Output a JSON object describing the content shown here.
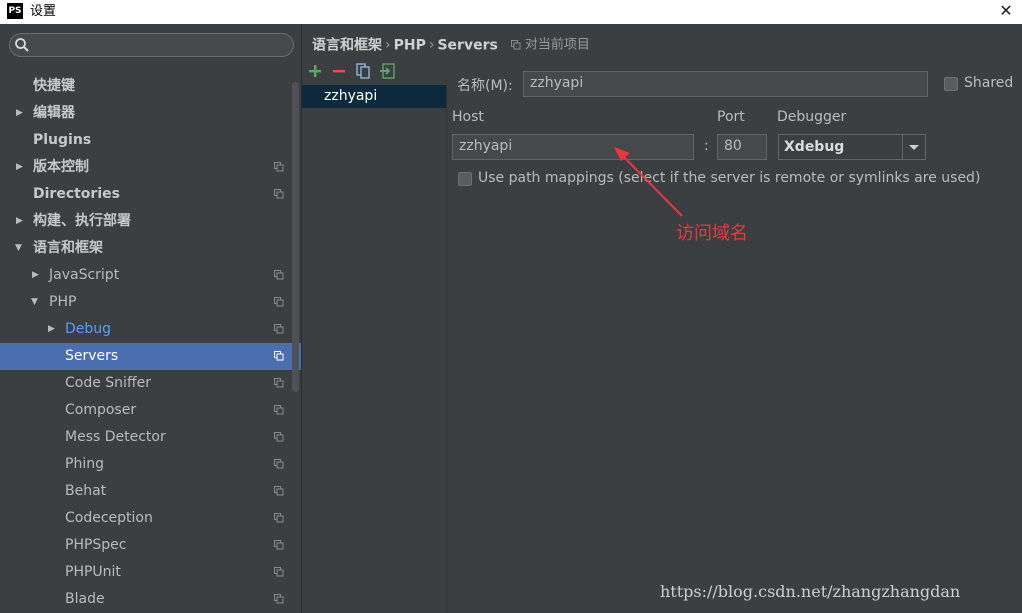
{
  "window": {
    "app_icon_text": "PS",
    "title": "设置",
    "close_glyph": "✕"
  },
  "search": {
    "placeholder": ""
  },
  "tree": {
    "items": [
      {
        "label": "快捷键"
      },
      {
        "label": "编辑器"
      },
      {
        "label": "Plugins"
      },
      {
        "label": "版本控制"
      },
      {
        "label": "Directories"
      },
      {
        "label": "构建、执行部署"
      },
      {
        "label": "语言和框架"
      },
      {
        "label": "JavaScript"
      },
      {
        "label": "PHP"
      },
      {
        "label": "Debug"
      },
      {
        "label": "Servers"
      },
      {
        "label": "Code Sniffer"
      },
      {
        "label": "Composer"
      },
      {
        "label": "Mess Detector"
      },
      {
        "label": "Phing"
      },
      {
        "label": "Behat"
      },
      {
        "label": "Codeception"
      },
      {
        "label": "PHPSpec"
      },
      {
        "label": "PHPUnit"
      },
      {
        "label": "Blade"
      }
    ]
  },
  "breadcrumb": {
    "part1": "语言和框架",
    "sep1": "›",
    "part2": "PHP",
    "sep2": "›",
    "part3": "Servers",
    "scope": "对当前项目"
  },
  "servers": {
    "list": [
      "zzhyapi"
    ]
  },
  "form": {
    "name_label": "名称(M):",
    "name_value": "zzhyapi",
    "shared_label": "Shared",
    "host_label": "Host",
    "host_value": "zzhyapi",
    "colon": ":",
    "port_label": "Port",
    "port_value": "80",
    "debugger_label": "Debugger",
    "debugger_value": "Xdebug",
    "path_mappings_label": "Use path mappings (select if the server is remote or symlinks are used)"
  },
  "annotation": {
    "text": "访问域名",
    "color": "#e8383d"
  },
  "watermark": "https://blog.csdn.net/zhangzhangdan",
  "colors": {
    "selection": "#4b6eaf",
    "background": "#3c3f41",
    "link": "#589df6",
    "add": "#59a869",
    "remove": "#d9534f"
  }
}
